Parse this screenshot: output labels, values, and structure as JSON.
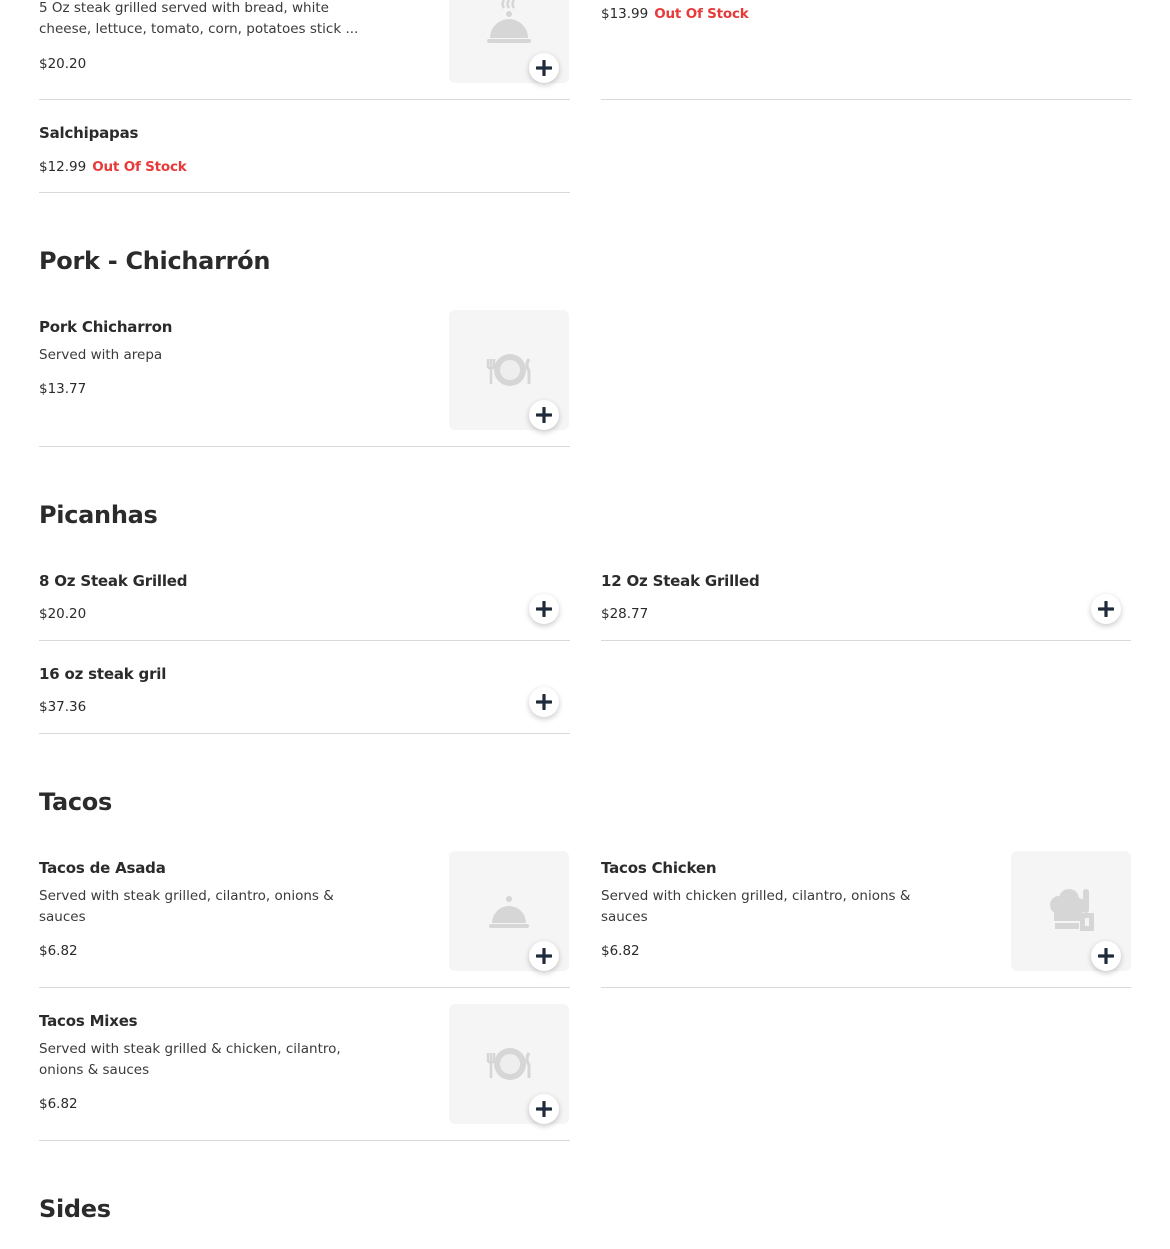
{
  "theme": {
    "accent_out_of_stock": "#e83a3a",
    "text": "#2b2b2b",
    "divider": "#d9d9d9",
    "thumb_bg": "#f5f5f5"
  },
  "top_items": [
    {
      "desc_line1": "5 Oz steak grilled served with bread, white",
      "desc_line2": "cheese, lettuce, tomato, corn, potatoes stick ...",
      "price": "$20.20",
      "icon": "cloche-steam-icon"
    },
    {
      "price": "$13.99",
      "status": "Out Of Stock"
    },
    {
      "name": "Salchipapas",
      "price": "$12.99",
      "status": "Out Of Stock"
    }
  ],
  "sections": [
    {
      "title": "Pork - Chicharrón",
      "items": [
        {
          "name": "Pork Chicharron",
          "desc": "Served with arepa",
          "price": "$13.77",
          "icon": "plate-cutlery-icon"
        }
      ]
    },
    {
      "title": "Picanhas",
      "items": [
        {
          "name": "8 Oz Steak Grilled",
          "price": "$20.20"
        },
        {
          "name": "12 Oz Steak Grilled",
          "price": "$28.77"
        },
        {
          "name": "16 oz steak gril",
          "price": "$37.36"
        }
      ]
    },
    {
      "title": "Tacos",
      "items": [
        {
          "name": "Tacos de Asada",
          "desc_line1": "Served with steak grilled, cilantro, onions &",
          "desc_line2": "sauces",
          "price": "$6.82",
          "icon": "cloche-icon"
        },
        {
          "name": "Tacos Chicken",
          "desc_line1": "Served with chicken grilled, cilantro, onions &",
          "desc_line2": "sauces",
          "price": "$6.82",
          "icon": "chef-hat-icon"
        },
        {
          "name": "Tacos Mixes",
          "desc_line1": "Served with steak grilled & chicken, cilantro,",
          "desc_line2": "onions & sauces",
          "price": "$6.82",
          "icon": "plate-cutlery-icon"
        }
      ]
    },
    {
      "title": "Sides",
      "items": []
    }
  ]
}
